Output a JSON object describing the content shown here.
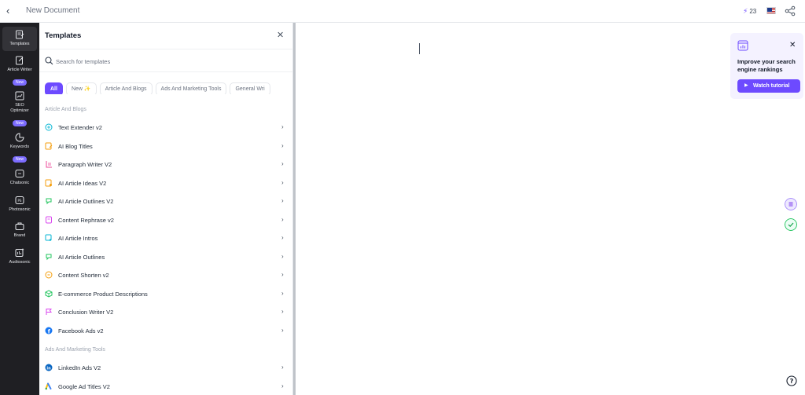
{
  "topbar": {
    "back_icon": "chevron-left-icon",
    "title": "New Document",
    "credits": "23",
    "credits_icon": "bolt-icon",
    "flag_icon": "us-flag-icon",
    "share_icon": "share-icon"
  },
  "leftnav": {
    "items": [
      {
        "label": "Templates",
        "icon": "templates-icon",
        "badge": ""
      },
      {
        "label": "Article Writer",
        "icon": "article-writer-icon",
        "badge": "New"
      },
      {
        "label": "SEO Optimizer",
        "icon": "seo-optimizer-icon",
        "badge": "New"
      },
      {
        "label": "Keywords",
        "icon": "keywords-icon",
        "badge": "New"
      },
      {
        "label": "Chatsonic",
        "icon": "chatsonic-icon",
        "badge": ""
      },
      {
        "label": "Photosonic",
        "icon": "photosonic-icon",
        "badge": ""
      },
      {
        "label": "Brand",
        "icon": "brand-icon",
        "badge": ""
      },
      {
        "label": "Audiosonic",
        "icon": "audiosonic-icon",
        "badge": ""
      }
    ]
  },
  "templates_panel": {
    "title": "Templates",
    "search_placeholder": "Search for templates",
    "chips": [
      "All",
      "New ✨",
      "Article And Blogs",
      "Ads And Marketing Tools",
      "General Wri"
    ],
    "sections": [
      {
        "label": "Article And Blogs",
        "items": [
          {
            "label": "Text Extender v2",
            "icon": "text-extender-icon",
            "color": "#06b6d4"
          },
          {
            "label": "AI Blog Titles",
            "icon": "blog-titles-icon",
            "color": "#f59e0b"
          },
          {
            "label": "Paragraph Writer V2",
            "icon": "paragraph-writer-icon",
            "color": "#ec4899"
          },
          {
            "label": "AI Article Ideas V2",
            "icon": "article-ideas-icon",
            "color": "#f59e0b"
          },
          {
            "label": "AI Article Outlines V2",
            "icon": "article-outlines-icon",
            "color": "#22c55e"
          },
          {
            "label": "Content Rephrase v2",
            "icon": "content-rephrase-icon",
            "color": "#d946ef"
          },
          {
            "label": "AI Article Intros",
            "icon": "article-intros-icon",
            "color": "#06b6d4"
          },
          {
            "label": "AI Article Outlines",
            "icon": "article-outlines-icon",
            "color": "#22c55e"
          },
          {
            "label": "Content Shorten v2",
            "icon": "content-shorten-icon",
            "color": "#f59e0b"
          },
          {
            "label": "E-commerce Product Descriptions",
            "icon": "ecommerce-icon",
            "color": "#22c55e"
          },
          {
            "label": "Conclusion Writer V2",
            "icon": "conclusion-writer-icon",
            "color": "#d946ef"
          },
          {
            "label": "Facebook Ads v2",
            "icon": "facebook-icon",
            "color": "#1877f2"
          }
        ]
      },
      {
        "label": "Ads And Marketing Tools",
        "items": [
          {
            "label": "LinkedIn Ads V2",
            "icon": "linkedin-icon",
            "color": "#0a66c2"
          },
          {
            "label": "Google Ad Titles V2",
            "icon": "google-ads-icon",
            "color": "#4285f4"
          }
        ]
      }
    ]
  },
  "promo": {
    "icon": "chart-window-icon",
    "text": "Improve your search engine rankings",
    "button_label": "Watch tutorial",
    "close_icon": "close-icon"
  },
  "editor_side_buttons": [
    {
      "icon": "list-icon",
      "color": "#a78bfa"
    },
    {
      "icon": "check-icon",
      "color": "#22c55e"
    }
  ],
  "help_icon": "help-icon",
  "colors": {
    "accent": "#6d4aff",
    "nav_bg": "#1f1f23",
    "promo_bg": "#f4f2ff"
  }
}
